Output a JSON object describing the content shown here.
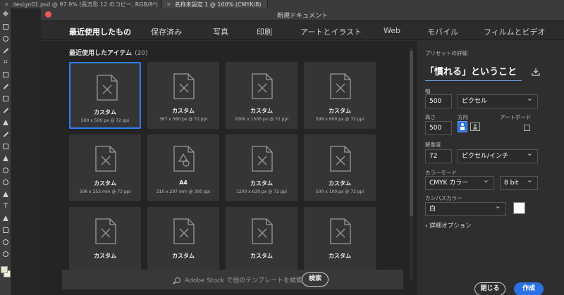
{
  "doc_tabs": [
    {
      "label": "design01.psd @ 97.9% (長方形 12 のコピー, RGB/8*)",
      "active": false
    },
    {
      "label": "名称未設定 1 @ 100% (CMYK/8)",
      "active": true
    }
  ],
  "dialog": {
    "title": "新規ドキュメント",
    "tabs": [
      "最近使用したもの",
      "保存済み",
      "写真",
      "印刷",
      "アートとイラスト",
      "Web",
      "モバイル",
      "フィルムとビデオ"
    ],
    "active_tab": 0
  },
  "recent": {
    "heading": "最近使用したアイテム",
    "count": "(20)",
    "items": [
      {
        "name": "カスタム",
        "size": "500 x 500 px @ 72 ppi",
        "icon": "document-brush-icon",
        "selected": true
      },
      {
        "name": "カスタム",
        "size": "367 x 560 px @ 72 ppi",
        "icon": "document-brush-icon"
      },
      {
        "name": "カスタム",
        "size": "2000 x 1500 px @ 72 ppi",
        "icon": "document-brush-icon"
      },
      {
        "name": "カスタム",
        "size": "599 x 600 px @ 72 ppi",
        "icon": "document-brush-icon"
      },
      {
        "name": "カスタム",
        "size": "506 x 253 mm @ 72 ppi",
        "icon": "document-brush-icon"
      },
      {
        "name": "A4",
        "size": "210 x 297 mm @ 300 ppi",
        "icon": "document-shapes-icon"
      },
      {
        "name": "カスタム",
        "size": "1200 x 630 px @ 72 ppi",
        "icon": "document-brush-icon"
      },
      {
        "name": "カスタム",
        "size": "500 x 100 px @ 72 ppi",
        "icon": "document-brush-icon"
      },
      {
        "name": "カスタム",
        "size": "",
        "icon": "document-brush-icon"
      },
      {
        "name": "カスタム",
        "size": "",
        "icon": "document-brush-icon"
      },
      {
        "name": "カスタム",
        "size": "",
        "icon": "document-brush-icon"
      },
      {
        "name": "カスタム",
        "size": "",
        "icon": "document-brush-icon"
      }
    ]
  },
  "search": {
    "placeholder": "Adobe Stock で他のテンプレートを検索",
    "button": "検索"
  },
  "preset": {
    "heading": "プリセットの詳細",
    "name": "「慣れる」ということ",
    "width_label": "幅",
    "width_value": "500",
    "unit": "ピクセル",
    "height_label": "高さ",
    "height_value": "500",
    "orientation_label": "方向",
    "artboard_label": "アートボード",
    "resolution_label": "解像度",
    "resolution_value": "72",
    "resolution_unit": "ピクセル/インチ",
    "color_mode_label": "カラーモード",
    "color_mode": "CMYK カラー",
    "bit_depth": "8 bit",
    "canvas_color_label": "カンバスカラー",
    "canvas_color": "白",
    "canvas_swatch": "#ffffff",
    "advanced": "詳細オプション",
    "close_button": "閉じる",
    "create_button": "作成"
  },
  "colors": {
    "accent": "#2d7ff9",
    "create": "#2a72e3",
    "close_dot": "#ee5a52"
  }
}
